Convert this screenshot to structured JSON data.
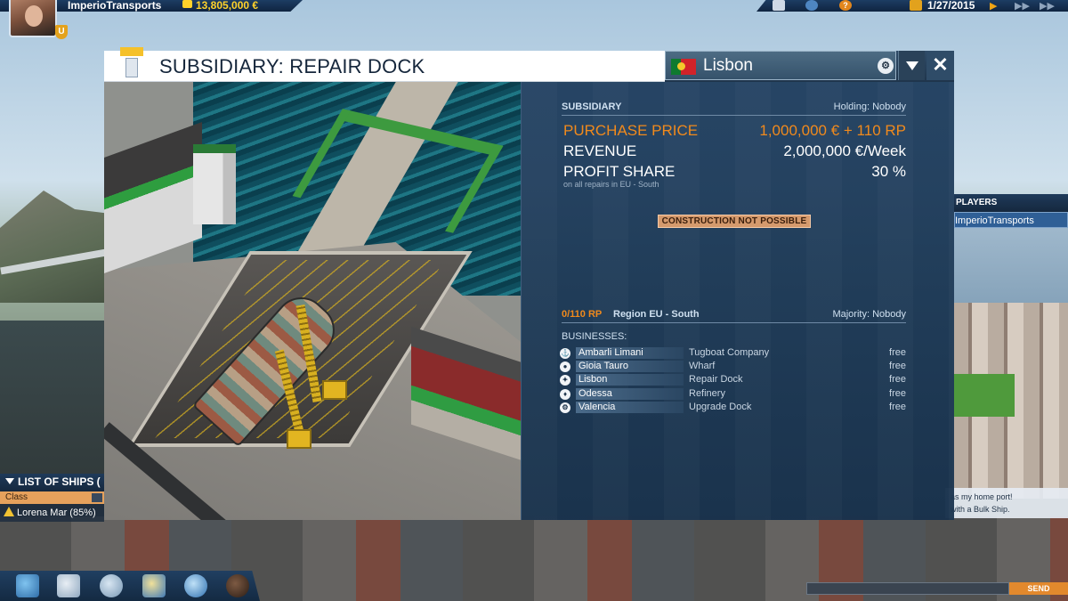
{
  "hud": {
    "company": "ImperioTransports",
    "money": "13,805,000 €",
    "date": "1/27/2015"
  },
  "dialog": {
    "title": "SUBSIDIARY: REPAIR DOCK",
    "location": "Lisbon",
    "info": {
      "section_label": "SUBSIDIARY",
      "holding": "Holding: Nobody",
      "purchase_price_label": "PURCHASE PRICE",
      "purchase_price_value": "1,000,000 € + 110 RP",
      "revenue_label": "REVENUE",
      "revenue_value": "2,000,000 €/Week",
      "profit_share_label": "PROFIT SHARE",
      "profit_share_value": "30 %",
      "profit_share_note": "on all repairs in EU - South",
      "construction_button": "CONSTRUCTION NOT POSSIBLE"
    },
    "region": {
      "rp": "0/110 RP",
      "name": "Region EU - South",
      "majority": "Majority: Nobody",
      "businesses_label": "BUSINESSES:",
      "businesses": [
        {
          "city": "Ambarli Limani",
          "type": "Tugboat Company",
          "status": "free",
          "icon": "tugboat-icon"
        },
        {
          "city": "Gioia Tauro",
          "type": "Wharf",
          "status": "free",
          "icon": "wharf-icon"
        },
        {
          "city": "Lisbon",
          "type": "Repair Dock",
          "status": "free",
          "icon": "repair-dock-icon"
        },
        {
          "city": "Odessa",
          "type": "Refinery",
          "status": "free",
          "icon": "refinery-icon"
        },
        {
          "city": "Valencia",
          "type": "Upgrade Dock",
          "status": "free",
          "icon": "upgrade-dock-icon"
        }
      ]
    }
  },
  "players": {
    "header": "PLAYERS",
    "entry": "ImperioTransports"
  },
  "ships": {
    "header": "LIST OF SHIPS (",
    "filter": "Class",
    "row": "Lorena Mar (85%)"
  },
  "chat": {
    "line1": "as my home port!",
    "line2": "with a Bulk Ship.",
    "send": "SEND"
  },
  "colors": {
    "accent_orange": "#f18a1c",
    "panel_blue": "#203f5f",
    "money_yellow": "#ffd22a"
  }
}
